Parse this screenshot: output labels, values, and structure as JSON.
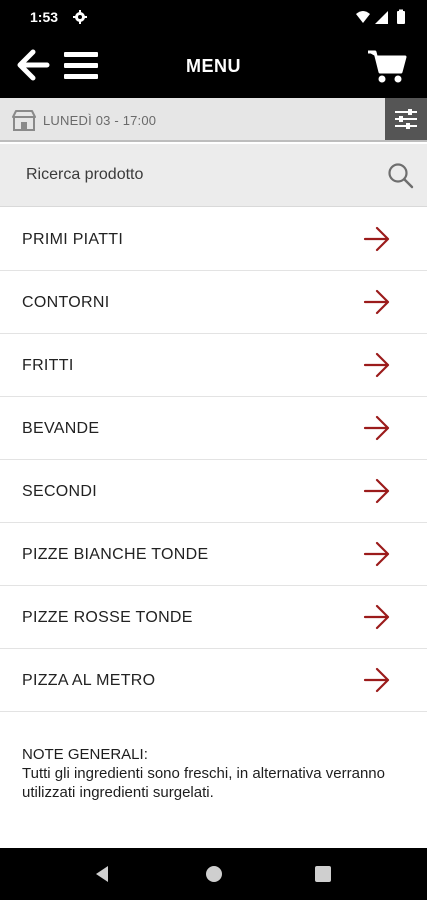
{
  "status_bar": {
    "time": "1:53"
  },
  "header": {
    "title": "MENU"
  },
  "slot": {
    "text": "LUNEDÌ 03 - 17:00"
  },
  "search": {
    "placeholder": "Ricerca prodotto"
  },
  "categories": [
    {
      "label": "PRIMI PIATTI"
    },
    {
      "label": "CONTORNI"
    },
    {
      "label": "FRITTI"
    },
    {
      "label": "BEVANDE"
    },
    {
      "label": "SECONDI"
    },
    {
      "label": "PIZZE BIANCHE TONDE"
    },
    {
      "label": "PIZZE ROSSE TONDE"
    },
    {
      "label": "PIZZA AL METRO"
    }
  ],
  "notes": {
    "title": "NOTE GENERALI:",
    "text": "Tutti gli ingredienti sono freschi, in alternativa verranno utilizzati ingredienti surgelati."
  },
  "colors": {
    "accent": "#9b1b1b",
    "header_bg": "#000000",
    "slot_bg": "#e6e6e6",
    "search_bg": "#ececec"
  }
}
